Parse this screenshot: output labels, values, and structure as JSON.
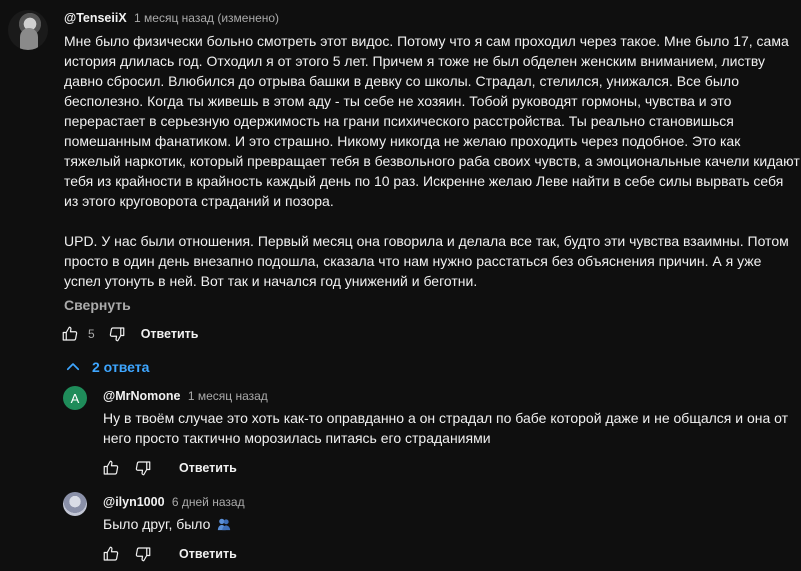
{
  "main_comment": {
    "author": "@TenseiiX",
    "time": "1 месяц назад (изменено)",
    "paragraph1": "Мне было физически больно смотреть этот видос. Потому что я сам проходил через такое. Мне было 17, сама история длилась год. Отходил я от этого 5 лет. Причем я тоже не был обделен женским вниманием, листву давно сбросил. Влюбился до отрыва башки в девку со школы. Страдал, стелился, унижался. Все было бесполезно. Когда ты живешь в этом аду - ты себе не хозяин. Тобой руководят гормоны, чувства и это перерастает в серьезную одержимость на грани психического расстройства. Ты реально становишься помешанным фанатиком. И это страшно. Никому никогда не желаю проходить через подобное. Это как тяжелый наркотик, который превращает тебя в безвольного раба своих чувств, а эмоциональные качели кидают тебя из крайности в крайность каждый день по 10 раз. Искренне желаю Леве найти в себе силы вырвать себя из этого круговорота страданий и позора.",
    "paragraph2": "UPD. У нас были отношения. Первый месяц она говорила и делала все так, будто эти чувства взаимны. Потом просто в один день внезапно подошла, сказала что нам нужно расстаться без объяснения причин. А я уже успел утонуть в ней. Вот так и начался год унижений и беготни.",
    "collapse_label": "Свернуть",
    "like_count": "5",
    "reply_label": "Ответить"
  },
  "replies_toggle": {
    "label": "2 ответа"
  },
  "replies": [
    {
      "avatar_letter": "A",
      "author": "@MrNomone",
      "time": "1 месяц назад",
      "text": "Ну в твоём случае это хоть как-то оправданно а он страдал по бабе которой даже и не общался и она от него просто тактично морозилась питаясь его страданиями",
      "reply_label": "Ответить"
    },
    {
      "author": "@ilyn1000",
      "time": "6 дней назад",
      "text": "Было друг, было",
      "reply_label": "Ответить"
    }
  ],
  "colors": {
    "background": "#0f0f0f",
    "text": "#f1f1f1",
    "secondary": "#aaaaaa",
    "link_blue": "#3ea6ff",
    "avatar_green": "#1f8c5a"
  }
}
